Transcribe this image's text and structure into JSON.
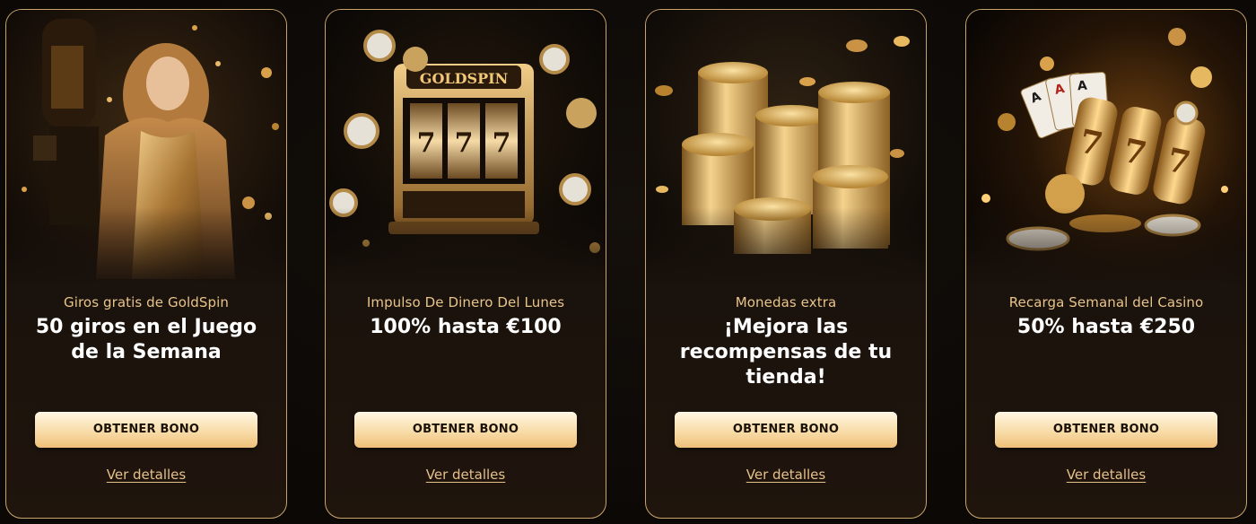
{
  "cards": [
    {
      "subtitle": "Giros gratis de GoldSpin",
      "headline": "50 giros en el Juego de la Semana",
      "cta_label": "OBTENER BONO",
      "details_label": "Ver detalles",
      "art": "woman-gold-dress-icon"
    },
    {
      "subtitle": "Impulso De Dinero Del Lunes",
      "headline": "100% hasta €100",
      "cta_label": "OBTENER BONO",
      "details_label": "Ver detalles",
      "art": "slot-machine-icon",
      "art_logo_text": "GOLDSPIN"
    },
    {
      "subtitle": "Monedas extra",
      "headline": "¡Mejora las recompensas de tu tienda!",
      "cta_label": "OBTENER BONO",
      "details_label": "Ver detalles",
      "art": "coin-stacks-icon"
    },
    {
      "subtitle": "Recarga Semanal del Casino",
      "headline": "50% hasta €250",
      "cta_label": "OBTENER BONO",
      "details_label": "Ver detalles",
      "art": "cards-and-reels-icon"
    }
  ],
  "colors": {
    "border": "#c9a46a",
    "subtitle": "#e9c48a",
    "button_top": "#fff6e2",
    "button_bottom": "#efc07a",
    "card_bg": "#1a120c"
  }
}
